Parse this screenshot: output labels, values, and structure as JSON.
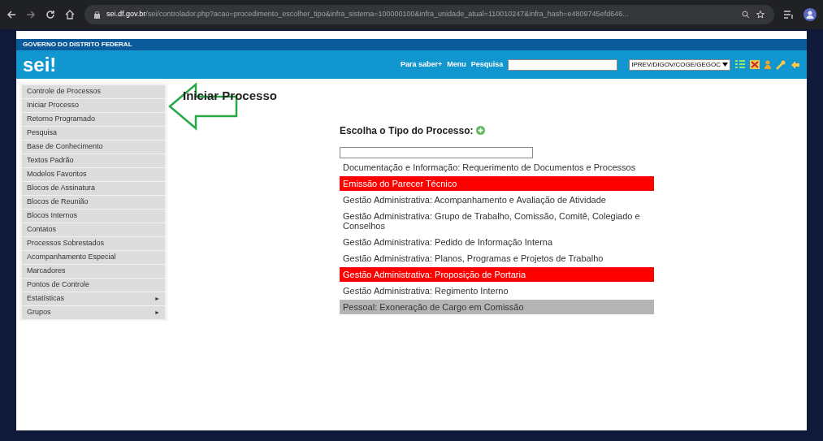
{
  "browser": {
    "url_domain": "sei.df.gov.br",
    "url_path": "/sei/controlador.php?acao=procedimento_escolher_tipo&infra_sistema=100000100&infra_unidade_atual=110010247&infra_hash=e4809745efd646..."
  },
  "header": {
    "org": "GOVERNO DO DISTRITO FEDERAL",
    "logo": "sei!",
    "links": [
      "Para saber+",
      "Menu",
      "Pesquisa"
    ],
    "unit": "IPREV/DIGOV/COGE/GEGOC"
  },
  "sidebar": {
    "items": [
      {
        "label": "Controle de Processos"
      },
      {
        "label": "Iniciar Processo"
      },
      {
        "label": "Retorno Programado"
      },
      {
        "label": "Pesquisa"
      },
      {
        "label": "Base de Conhecimento"
      },
      {
        "label": "Textos Padrão"
      },
      {
        "label": "Modelos Favoritos"
      },
      {
        "label": "Blocos de Assinatura"
      },
      {
        "label": "Blocos de Reunião"
      },
      {
        "label": "Blocos Internos"
      },
      {
        "label": "Contatos"
      },
      {
        "label": "Processos Sobrestados"
      },
      {
        "label": "Acompanhamento Especial"
      },
      {
        "label": "Marcadores"
      },
      {
        "label": "Pontos de Controle"
      },
      {
        "label": "Estatísticas",
        "arrow": "►"
      },
      {
        "label": "Grupos",
        "arrow": "►"
      }
    ]
  },
  "main": {
    "title": "Iniciar Processo",
    "heading": "Escolha o Tipo do Processo:",
    "types": [
      {
        "label": "Documentação e Informação: Requerimento de Documentos e Processos",
        "marked": false,
        "selected": false
      },
      {
        "label": "Emissão do Parecer Técnico",
        "marked": true,
        "selected": false
      },
      {
        "label": "Gestão Administrativa: Acompanhamento e Avaliação de Atividade",
        "marked": false,
        "selected": false
      },
      {
        "label": "Gestão Administrativa: Grupo de Trabalho, Comissão, Comitê, Colegiado e Conselhos",
        "marked": false,
        "selected": false
      },
      {
        "label": "Gestão Administrativa: Pedido de Informação Interna",
        "marked": false,
        "selected": false
      },
      {
        "label": "Gestão Administrativa: Planos, Programas e Projetos de Trabalho",
        "marked": false,
        "selected": false
      },
      {
        "label": "Gestão Administrativa: Proposição de Portaria",
        "marked": true,
        "selected": false
      },
      {
        "label": "Gestão Administrativa: Regimento Interno",
        "marked": false,
        "selected": false
      },
      {
        "label": "Pessoal: Exoneração de Cargo em Comissão",
        "marked": false,
        "selected": true
      }
    ]
  }
}
